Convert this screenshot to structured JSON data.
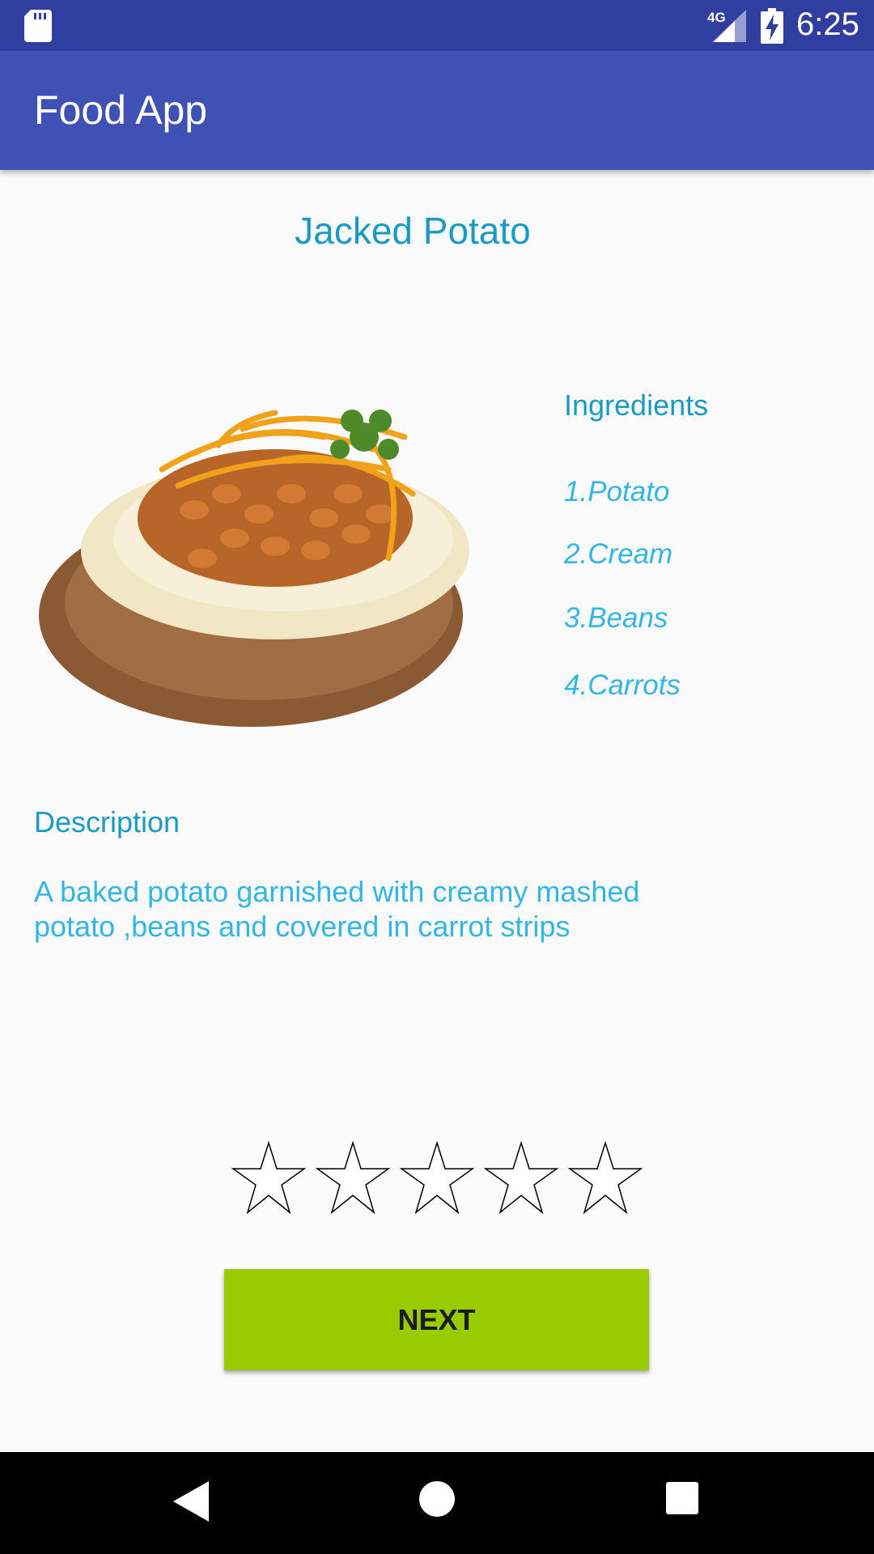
{
  "status_bar": {
    "network": "4G",
    "time": "6:25",
    "icons": [
      "sd-card-icon",
      "signal-icon",
      "battery-charging-icon"
    ]
  },
  "app_bar": {
    "title": "Food App"
  },
  "food": {
    "title": "Jacked Potato",
    "image": "baked-potato-with-beans-and-cheese"
  },
  "ingredients": {
    "title": "Ingredients",
    "items": [
      "1.Potato",
      "2.Cream",
      "3.Beans",
      "4.Carrots"
    ]
  },
  "description": {
    "title": "Description",
    "text": "A baked potato garnished with creamy mashed potato ,beans and covered in carrot strips"
  },
  "rating": {
    "value": 0,
    "max": 5
  },
  "next_button": {
    "label": "NEXT"
  },
  "nav_bar": {
    "icons": [
      "back-icon",
      "home-icon",
      "recent-apps-icon"
    ]
  },
  "colors": {
    "status_bar": "#303f9f",
    "app_bar": "#3f51b5",
    "title_text": "#1a9bc7",
    "body_text": "#33b5e5",
    "next_button": "#99cc00"
  }
}
